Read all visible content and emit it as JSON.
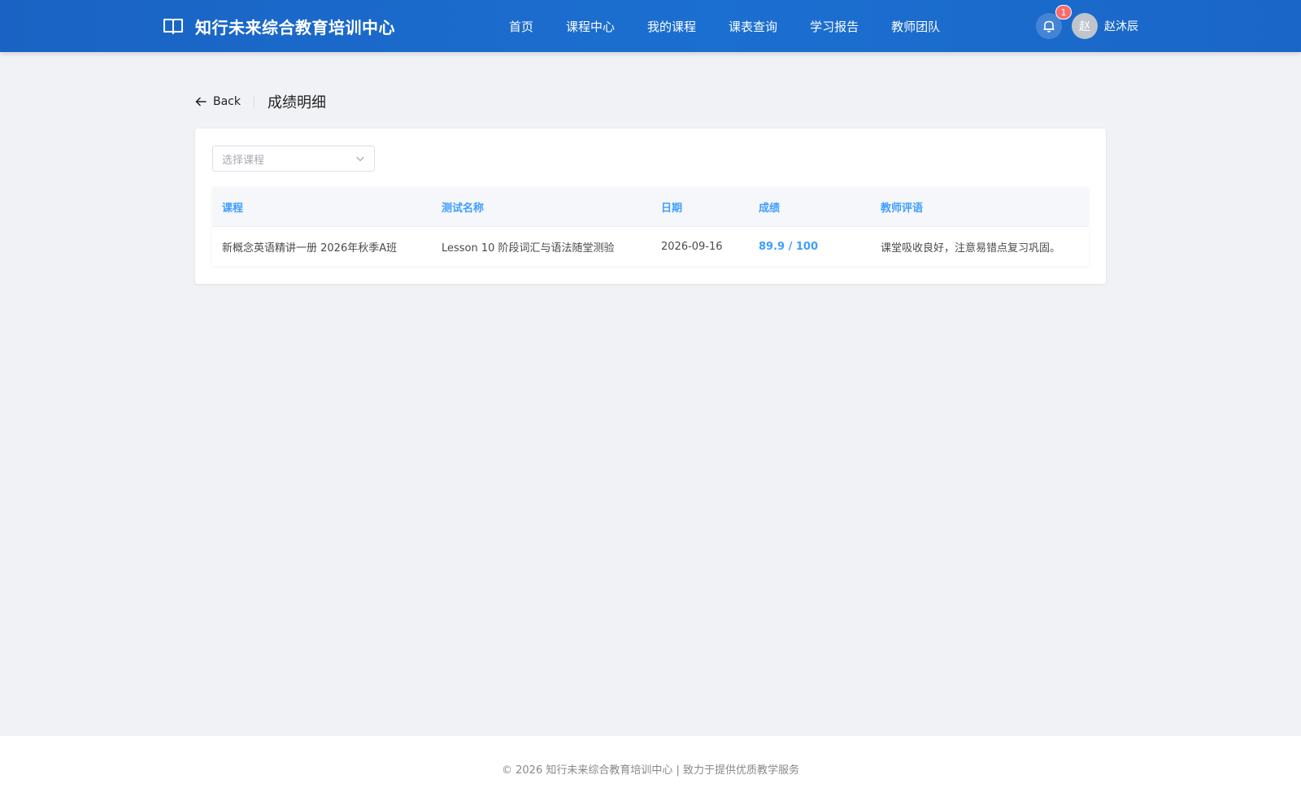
{
  "header": {
    "brand_title": "知行未来综合教育培训中心",
    "nav": [
      "首页",
      "课程中心",
      "我的课程",
      "课表查询",
      "学习报告",
      "教师团队"
    ],
    "notification_count": "1",
    "avatar_initial": "赵",
    "username": "赵沐辰"
  },
  "page": {
    "back_label": "Back",
    "title": "成绩明细"
  },
  "filter": {
    "course_select_placeholder": "选择课程"
  },
  "table": {
    "columns": [
      "课程",
      "测试名称",
      "日期",
      "成绩",
      "教师评语"
    ],
    "rows": [
      {
        "course": "新概念英语精讲一册 2026年秋季A班",
        "test_name": "Lesson 10 阶段词汇与语法随堂测验",
        "date": "2026-09-16",
        "score": "89.9 / 100",
        "comment": "课堂吸收良好，注意易错点复习巩固。"
      }
    ]
  },
  "footer": {
    "text": "© 2026 知行未来综合教育培训中心 | 致力于提供优质教学服务"
  },
  "colors": {
    "header_bg": "#1b6fd0",
    "accent": "#409eff",
    "badge": "#f56c6c",
    "page_bg": "#f0f2f5"
  }
}
